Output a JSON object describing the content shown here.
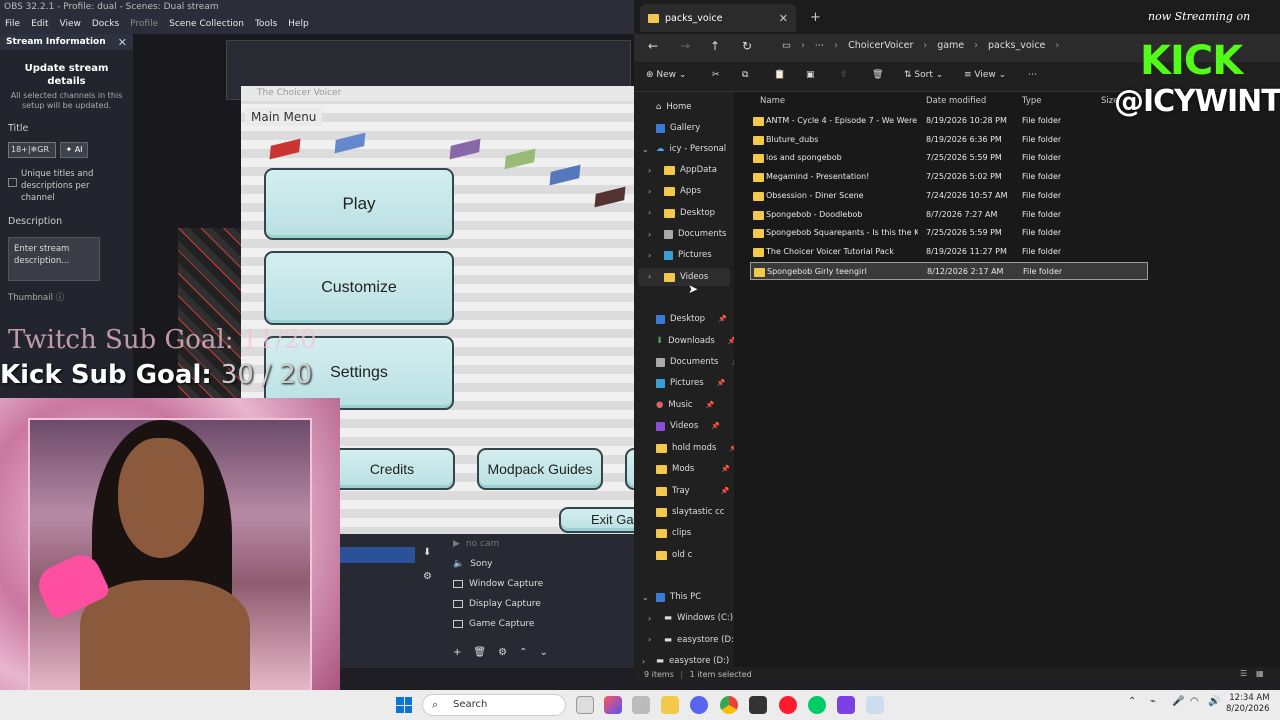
{
  "obs": {
    "title": "OBS 32.2.1 - Profile: dual - Scenes: Dual stream",
    "menu": [
      "File",
      "Edit",
      "View",
      "Docks",
      "Profile",
      "Scene Collection",
      "Tools",
      "Help"
    ]
  },
  "stream_info": {
    "header": "Stream Information",
    "update_title": "Update stream details",
    "note": "All selected channels in this setup will be updated.",
    "title_label": "Title",
    "title_value": "18+|❄GR",
    "ai_label": "AI",
    "unique_label": "Unique titles and descriptions per channel",
    "description_label": "Description",
    "description_placeholder": "Enter stream description...",
    "thumbnail_label": "Thumbnail"
  },
  "overlay": {
    "twitch_goal": "Twitch Sub Goal: 11/20",
    "kick_goal_label": "Kick Sub Goal:",
    "kick_goal_value": "30 / 20",
    "kick_streaming": "now Streaming on",
    "kick_brand": "KICK",
    "kick_handle": "@ICYWINTRR"
  },
  "game": {
    "window_title": "The Choicer Voicer",
    "menu_title": "Main Menu",
    "buttons": {
      "play": "Play",
      "customize": "Customize",
      "settings": "Settings",
      "credits": "Credits",
      "modpack": "Modpack Guides",
      "exit": "Exit Ga"
    }
  },
  "sources": {
    "items": [
      "no cam",
      "Sony",
      "Window Capture",
      "Display Capture",
      "Game Capture"
    ]
  },
  "explorer": {
    "tab_title": "packs_voice",
    "breadcrumbs": [
      "ChoicerVoicer",
      "game",
      "packs_voice"
    ],
    "commands": {
      "new": "New",
      "sort": "Sort",
      "view": "View"
    },
    "nav": {
      "home": "Home",
      "gallery": "Gallery",
      "personal": "icy - Personal",
      "appdata": "AppData",
      "apps": "Apps",
      "desktop": "Desktop",
      "documents": "Documents",
      "pictures": "Pictures",
      "videos": "Videos",
      "q_desktop": "Desktop",
      "q_downloads": "Downloads",
      "q_documents": "Documents",
      "q_pictures": "Pictures",
      "q_music": "Music",
      "q_videos": "Videos",
      "q_holdmods": "hold mods",
      "q_mods": "Mods",
      "q_tray": "Tray",
      "q_slaytastic": "slaytastic cc",
      "q_clips": "clips",
      "q_oldc": "old c",
      "this_pc": "This PC",
      "drive_c": "Windows (C:)",
      "drive_d1": "easystore (D:)",
      "drive_d2": "easystore (D:)"
    },
    "columns": {
      "name": "Name",
      "date": "Date modified",
      "type": "Type",
      "size": "Size"
    },
    "files": [
      {
        "name": "ANTM - Cycle 4 - Episode 7 - We Were Al...",
        "date": "8/19/2026 10:28 PM",
        "type": "File folder"
      },
      {
        "name": "Bluture_dubs",
        "date": "8/19/2026 6:36 PM",
        "type": "File folder"
      },
      {
        "name": "los and spongebob",
        "date": "7/25/2026 5:59 PM",
        "type": "File folder"
      },
      {
        "name": "Megamind - Presentation!",
        "date": "7/25/2026 5:02 PM",
        "type": "File folder"
      },
      {
        "name": "Obsession - Diner Scene",
        "date": "7/24/2026 10:57 AM",
        "type": "File folder"
      },
      {
        "name": "Spongebob - Doodlebob",
        "date": "8/7/2026 7:27 AM",
        "type": "File folder"
      },
      {
        "name": "Spongebob Squarepants - Is this the Krus...",
        "date": "7/25/2026 5:59 PM",
        "type": "File folder"
      },
      {
        "name": "The Choicer Voicer Tutorial Pack",
        "date": "8/19/2026 11:27 PM",
        "type": "File folder"
      },
      {
        "name": "Spongebob Girly teengirl",
        "date": "8/12/2026 2:17 AM",
        "type": "File folder"
      }
    ],
    "status_items": "9 items",
    "status_selected": "1 item selected"
  },
  "taskbar": {
    "search": "Search",
    "time": "12:34 AM",
    "date": "8/20/2026"
  }
}
